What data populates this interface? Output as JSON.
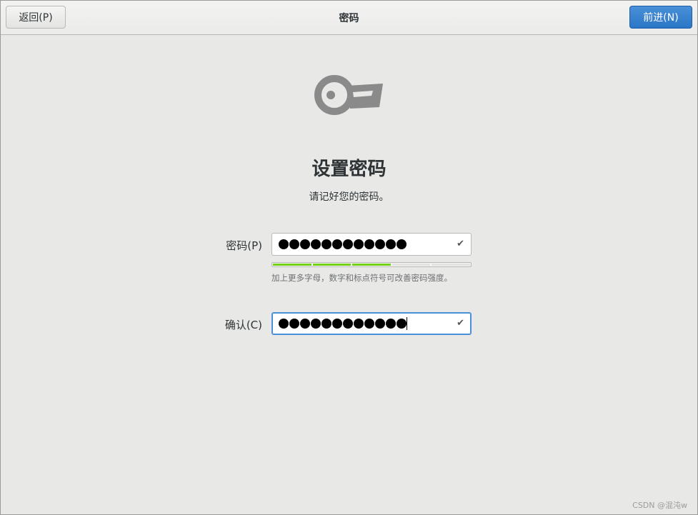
{
  "header": {
    "back_label": "返回(P)",
    "title": "密码",
    "next_label": "前进(N)"
  },
  "main": {
    "icon": "key-icon",
    "heading": "设置密码",
    "subtitle": "请记好您的密码。",
    "password": {
      "label": "密码(P)",
      "masked_length": 12,
      "status_icon": "checkmark-icon"
    },
    "strength": {
      "segments_total": 5,
      "segments_filled": 3,
      "fill_color": "#73d216",
      "hint": "加上更多字母，数字和标点符号可改善密码强度。"
    },
    "confirm": {
      "label": "确认(C)",
      "masked_length": 12,
      "status_icon": "checkmark-icon"
    }
  },
  "colors": {
    "accent": "#4a90d9",
    "background": "#e8e8e7"
  },
  "watermark": "CSDN @混沌w"
}
